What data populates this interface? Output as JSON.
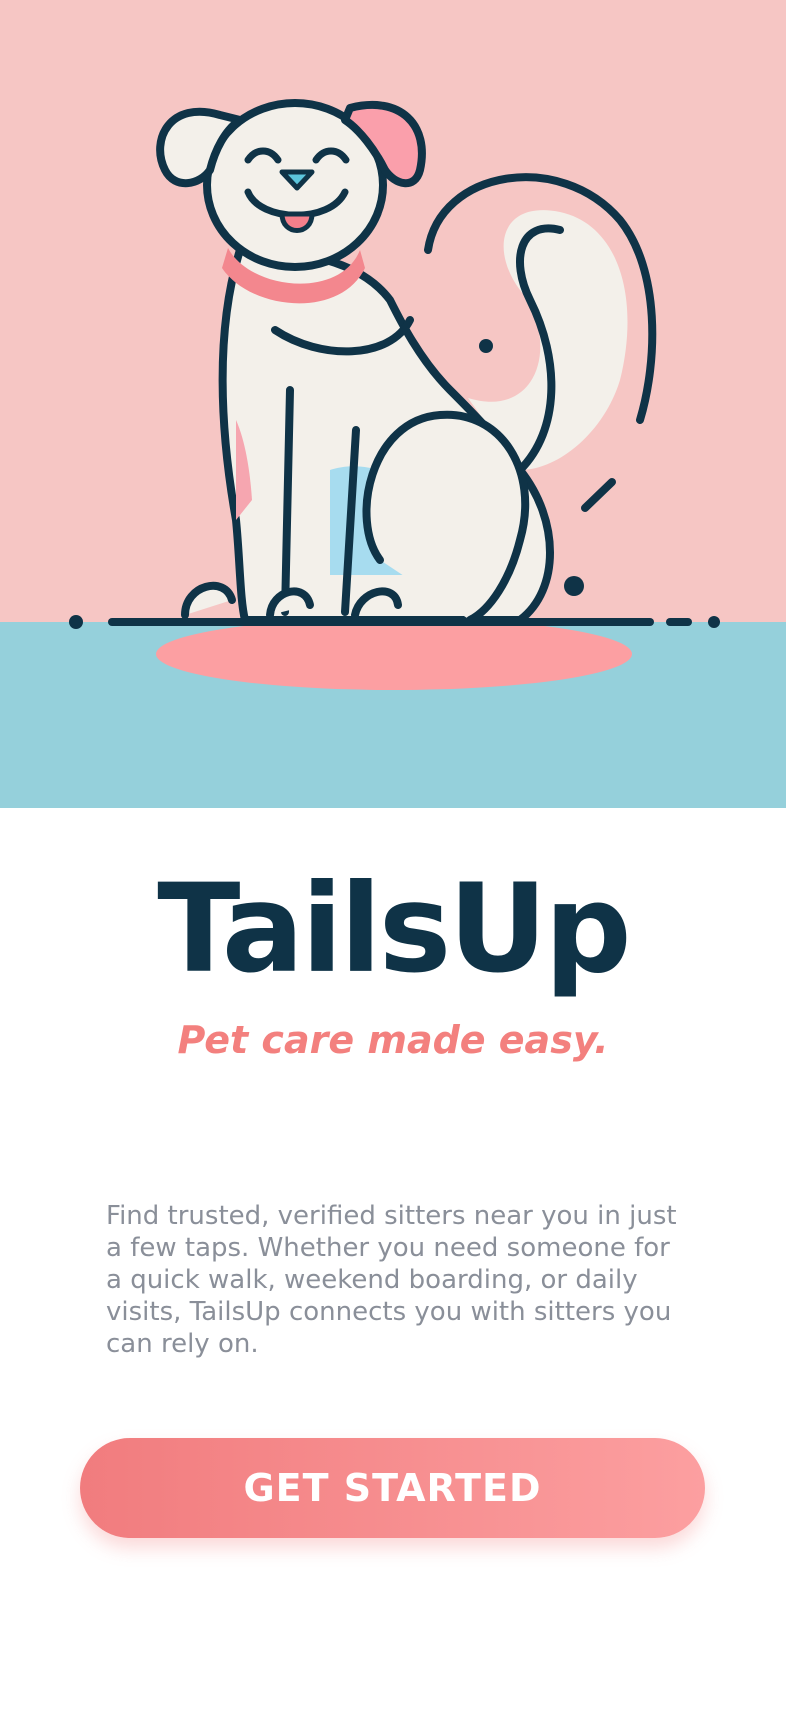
{
  "app": {
    "name": "TailsUp",
    "tagline": "Pet care made easy."
  },
  "hero": {
    "illustration": "smiling-dog-illustration",
    "colors": {
      "sky": "#f6c6c4",
      "ground": "#95d0db",
      "mat": "#fc9fa2",
      "outline": "#0f3347",
      "fur": "#f3f0ea"
    }
  },
  "intro": {
    "description": "Find trusted, verified sitters near you in just a few taps. Whether you need someone for a quick walk, weekend boarding, or daily visits, TailsUp connects you with sitters you can rely on."
  },
  "cta": {
    "label": "GET STARTED"
  },
  "theme": {
    "title_color": "#0f3347",
    "accent": "#f3807e",
    "body_text": "#8a8f99",
    "button_gradient": [
      "#f17c7e",
      "#fc9fa0"
    ]
  }
}
